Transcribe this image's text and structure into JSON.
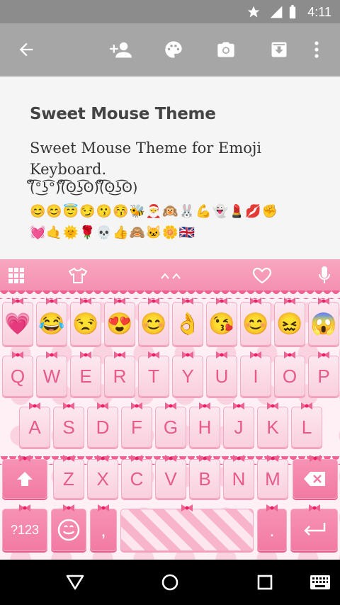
{
  "status_bar": {
    "time": "4:11",
    "icons": [
      "star-icon",
      "signal-icon",
      "battery-icon"
    ]
  },
  "toolbar": {
    "icons": [
      "back-arrow-icon",
      "add-person-icon",
      "palette-icon",
      "camera-icon",
      "download-icon",
      "more-vert-icon"
    ]
  },
  "content": {
    "title": "Sweet Mouse Theme",
    "description": "Sweet Mouse Theme for Emoji Keyboard.",
    "kaomoji": "(ຶ͡°͜ʖ͡°)(ຶ͡ʘ͜ʖ͡ʘ)(ຶ͡ʘ͜ʖ͡ʘ)",
    "emoji_row_1": "😊😊😇😏😗😚🐝🎅🙉🐰💪👻💄💋✊",
    "emoji_row_2": "💓🤙🌞🌹💀👍🙈🐱🌼🇬🇧"
  },
  "keyboard": {
    "topbar": {
      "icons": [
        "apps-grid-icon",
        "tshirt-icon",
        "caret-up-icon",
        "heart-icon",
        "mic-icon"
      ]
    },
    "emoji_keys": [
      "💗",
      "😂",
      "😒",
      "😍",
      "😊",
      "👌",
      "😘",
      "😊",
      "😖",
      "😱"
    ],
    "row1": [
      "Q",
      "W",
      "E",
      "R",
      "T",
      "Y",
      "U",
      "I",
      "O",
      "P"
    ],
    "row2": [
      "A",
      "S",
      "D",
      "F",
      "G",
      "H",
      "J",
      "K",
      "L"
    ],
    "row3": [
      "Z",
      "X",
      "C",
      "V",
      "B",
      "N",
      "M"
    ],
    "numbers_key": "?123",
    "comma": ",",
    "period": "."
  },
  "navbar": {
    "icons": [
      "back-triangle-icon",
      "home-circle-icon",
      "recents-square-icon",
      "keyboard-icon"
    ]
  },
  "colors": {
    "accent": "#e75a8b",
    "topbar": "#f48fb1",
    "toolbar": "#a6a6a6"
  }
}
